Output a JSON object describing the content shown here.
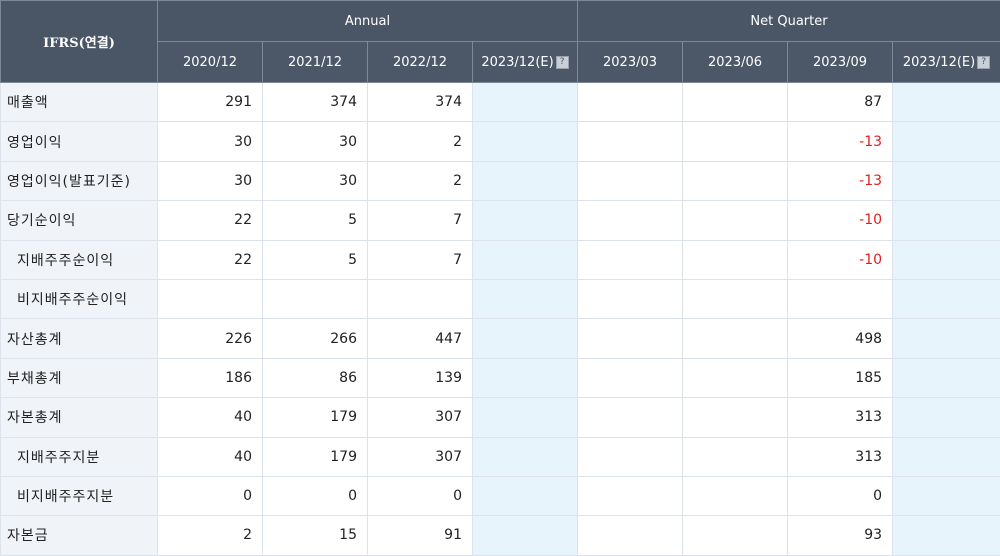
{
  "header": {
    "corner": "IFRS(연결)",
    "group_annual": "Annual",
    "group_quarter": "Net Quarter",
    "columns": [
      "2020/12",
      "2021/12",
      "2022/12",
      "2023/12(E)",
      "2023/03",
      "2023/06",
      "2023/09",
      "2023/12(E)"
    ],
    "estimate_columns": [
      3,
      7
    ],
    "help_icon": "question-icon"
  },
  "rows": [
    {
      "label": "매출액",
      "sub": false,
      "values": [
        "291",
        "374",
        "374",
        "",
        "",
        "",
        "87",
        ""
      ]
    },
    {
      "label": "영업이익",
      "sub": false,
      "values": [
        "30",
        "30",
        "2",
        "",
        "",
        "",
        "-13",
        ""
      ]
    },
    {
      "label": "영업이익(발표기준)",
      "sub": false,
      "values": [
        "30",
        "30",
        "2",
        "",
        "",
        "",
        "-13",
        ""
      ]
    },
    {
      "label": "당기순이익",
      "sub": false,
      "values": [
        "22",
        "5",
        "7",
        "",
        "",
        "",
        "-10",
        ""
      ]
    },
    {
      "label": "지배주주순이익",
      "sub": true,
      "values": [
        "22",
        "5",
        "7",
        "",
        "",
        "",
        "-10",
        ""
      ]
    },
    {
      "label": "비지배주주순이익",
      "sub": true,
      "values": [
        "",
        "",
        "",
        "",
        "",
        "",
        "",
        ""
      ]
    },
    {
      "label": "자산총계",
      "sub": false,
      "values": [
        "226",
        "266",
        "447",
        "",
        "",
        "",
        "498",
        ""
      ]
    },
    {
      "label": "부채총계",
      "sub": false,
      "values": [
        "186",
        "86",
        "139",
        "",
        "",
        "",
        "185",
        ""
      ]
    },
    {
      "label": "자본총계",
      "sub": false,
      "values": [
        "40",
        "179",
        "307",
        "",
        "",
        "",
        "313",
        ""
      ]
    },
    {
      "label": "지배주주지분",
      "sub": true,
      "values": [
        "40",
        "179",
        "307",
        "",
        "",
        "",
        "313",
        ""
      ]
    },
    {
      "label": "비지배주주지분",
      "sub": true,
      "values": [
        "0",
        "0",
        "0",
        "",
        "",
        "",
        "0",
        ""
      ]
    },
    {
      "label": "자본금",
      "sub": false,
      "values": [
        "2",
        "15",
        "91",
        "",
        "",
        "",
        "93",
        ""
      ]
    }
  ],
  "colors": {
    "header_bg": "#4a5666",
    "label_bg": "#f0f4f8",
    "estimate_bg": "#e8f4fb",
    "negative": "#e21f1f"
  }
}
